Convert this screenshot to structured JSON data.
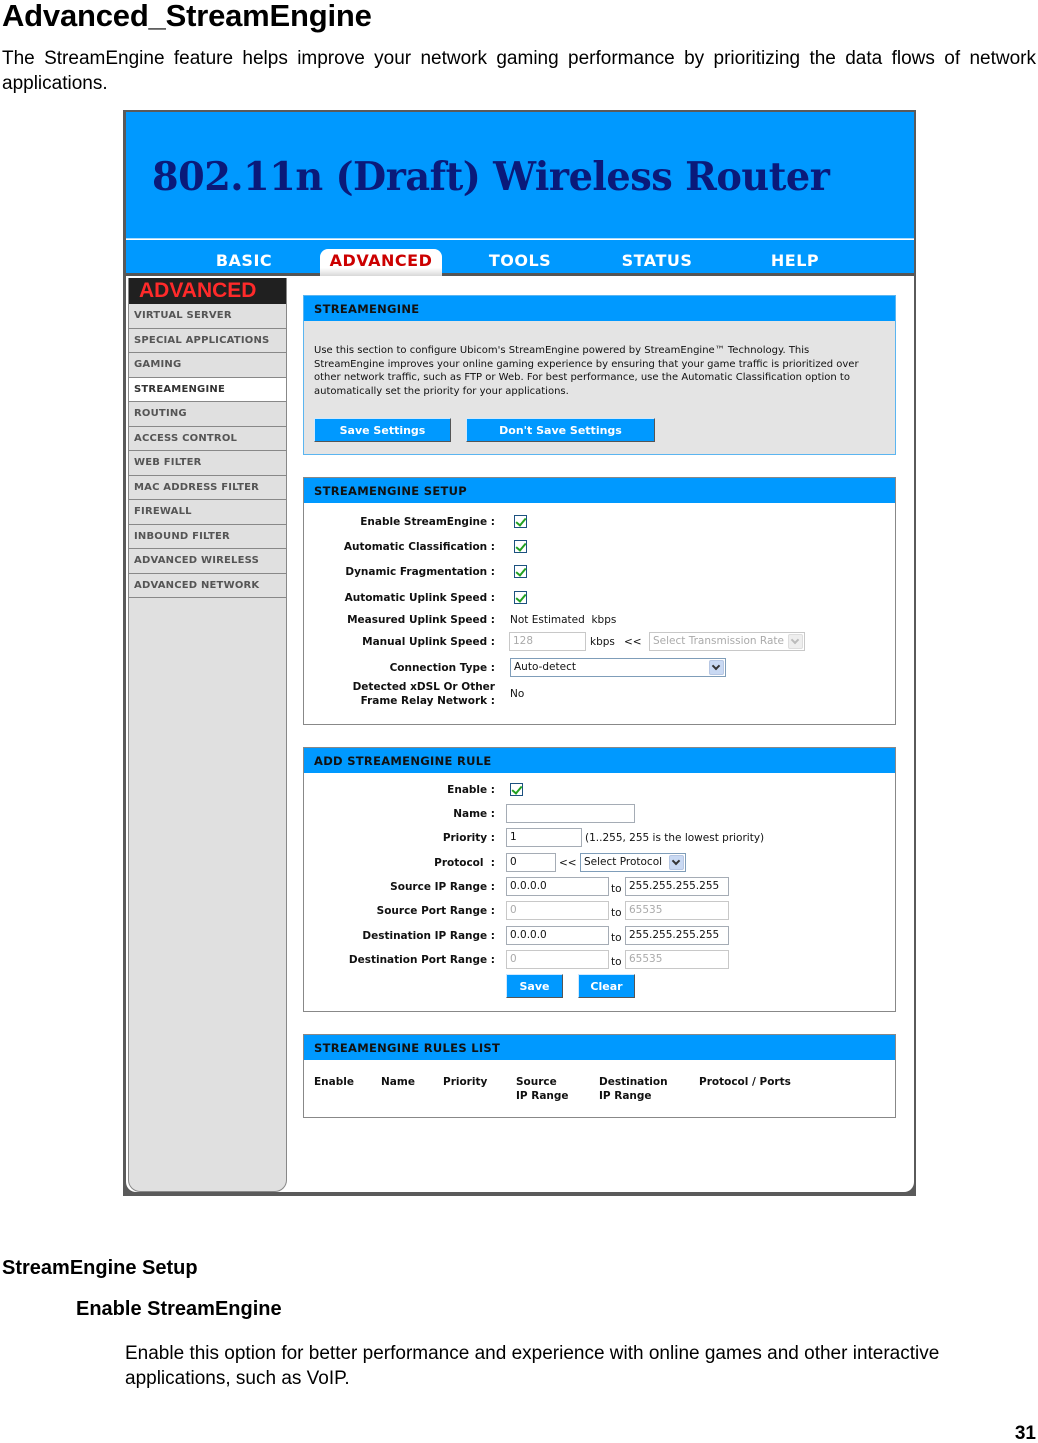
{
  "doc": {
    "title": "Advanced_StreamEngine",
    "intro": "The StreamEngine feature helps improve your network gaming performance by prioritizing the data flows of network applications.",
    "section_heading": "StreamEngine Setup",
    "subsection_heading": "Enable StreamEngine",
    "subsection_text": "Enable this option for better performance and experience with online games and other interactive applications, such as VoIP.",
    "page_number": "31"
  },
  "router": {
    "banner_title": "802.11n (Draft) Wireless Router",
    "nav_tabs": [
      {
        "label": "BASIC",
        "active": false
      },
      {
        "label": "ADVANCED",
        "active": true
      },
      {
        "label": "TOOLS",
        "active": false
      },
      {
        "label": "STATUS",
        "active": false
      },
      {
        "label": "HELP",
        "active": false
      }
    ],
    "sidebar": {
      "heading": "ADVANCED",
      "items": [
        {
          "label": "VIRTUAL SERVER"
        },
        {
          "label": "SPECIAL APPLICATIONS"
        },
        {
          "label": "GAMING"
        },
        {
          "label": "STREAMENGINE",
          "active": true
        },
        {
          "label": "ROUTING"
        },
        {
          "label": "ACCESS CONTROL"
        },
        {
          "label": "WEB FILTER"
        },
        {
          "label": "MAC ADDRESS FILTER"
        },
        {
          "label": "FIREWALL"
        },
        {
          "label": "INBOUND FILTER"
        },
        {
          "label": "ADVANCED WIRELESS"
        },
        {
          "label": "ADVANCED NETWORK"
        }
      ]
    },
    "intro_panel": {
      "title": "STREAMENGINE",
      "text": "Use this section to configure Ubicom's StreamEngine powered by StreamEngine™ Technology. This StreamEngine improves your online gaming experience by ensuring that your game traffic is prioritized over other network traffic, such as FTP or Web. For best performance, use the Automatic Classification option to automatically set the priority for your applications.",
      "save_label": "Save Settings",
      "dont_save_label": "Don't Save Settings"
    },
    "setup_panel": {
      "title": "STREAMENGINE SETUP",
      "enable_label": "Enable StreamEngine :",
      "enable_checked": true,
      "auto_class_label": "Automatic Classification :",
      "auto_class_checked": true,
      "dyn_frag_label": "Dynamic Fragmentation :",
      "dyn_frag_checked": true,
      "auto_uplink_label": "Automatic Uplink Speed :",
      "auto_uplink_checked": true,
      "measured_label": "Measured Uplink Speed :",
      "measured_value": "Not Estimated  kbps",
      "manual_label": "Manual Uplink Speed :",
      "manual_value": "128",
      "manual_unit": "kbps",
      "manual_arrow": "<<",
      "rate_select": "Select Transmission Rate",
      "conn_type_label": "Connection Type :",
      "conn_type_value": "Auto-detect",
      "xdsl_label_1": "Detected xDSL Or Other",
      "xdsl_label_2": "Frame Relay Network :",
      "xdsl_value": "No"
    },
    "rule_panel": {
      "title": "ADD STREAMENGINE RULE",
      "enable_label": "Enable :",
      "enable_checked": true,
      "name_label": "Name :",
      "name_value": "",
      "priority_label": "Priority :",
      "priority_value": "1",
      "priority_hint": "(1..255, 255 is the lowest priority)",
      "protocol_label": "Protocol  :",
      "protocol_value": "0",
      "protocol_arrow": "<<",
      "protocol_select": "Select Protocol",
      "src_ip_label": "Source IP Range :",
      "src_ip_from": "0.0.0.0",
      "src_ip_to": "255.255.255.255",
      "src_port_label": "Source Port Range :",
      "src_port_from": "0",
      "src_port_to": "65535",
      "dst_ip_label": "Destination IP Range :",
      "dst_ip_from": "0.0.0.0",
      "dst_ip_to": "255.255.255.255",
      "dst_port_label": "Destination Port Range :",
      "dst_port_from": "0",
      "dst_port_to": "65535",
      "to_label": "to",
      "save_label": "Save",
      "clear_label": "Clear"
    },
    "rules_list": {
      "title": "STREAMENGINE RULES LIST",
      "columns": [
        {
          "line1": "Enable",
          "line2": ""
        },
        {
          "line1": "Name",
          "line2": ""
        },
        {
          "line1": "Priority",
          "line2": ""
        },
        {
          "line1": "Source",
          "line2": "IP Range"
        },
        {
          "line1": "Destination",
          "line2": "IP Range"
        },
        {
          "line1": "Protocol / Ports",
          "line2": ""
        }
      ]
    }
  }
}
